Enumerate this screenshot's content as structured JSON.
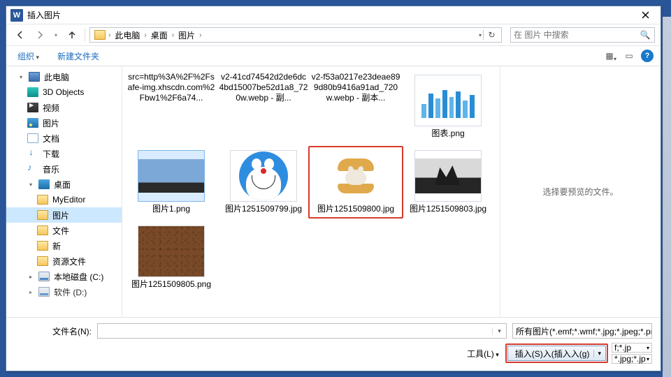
{
  "app_icon_letter": "W",
  "title": "插入图片",
  "nav": {
    "refresh_glyph": "↻",
    "search_glyph": "🔍"
  },
  "breadcrumb": [
    "此电脑",
    "桌面",
    "图片"
  ],
  "search": {
    "placeholder": "在 图片 中搜索"
  },
  "toolbar": {
    "organize": "组织",
    "new_folder": "新建文件夹",
    "view_icon": "▦",
    "preview_icon": "▭"
  },
  "tree": {
    "this_pc": "此电脑",
    "three_d": "3D Objects",
    "videos": "视频",
    "pictures": "图片",
    "documents": "文档",
    "downloads": "下载",
    "music": "音乐",
    "desktop": "桌面",
    "myeditor": "MyEditor",
    "pictures_folder": "图片",
    "files_folder": "文件",
    "new_folder": "新",
    "resources": "资源文件",
    "local_disk": "本地磁盘 (C:)",
    "partial": "软件 (D:)"
  },
  "files": [
    {
      "label": "src=http%3A%2F%2Fsafe-img.xhscdn.com%2Fbw1%2F6a74...",
      "thumb": "none"
    },
    {
      "label": "v2-41cd74542d2de6dc4bd15007be52d1a8_720w.webp - 副...",
      "thumb": "none"
    },
    {
      "label": "v2-f53a0217e23deae899d80b9416a91ad_720w.webp - 副本...",
      "thumb": "none"
    },
    {
      "label": "图表.png",
      "thumb": "chart"
    },
    {
      "label": "图片1.png",
      "thumb": "city",
      "selected": true
    },
    {
      "label": "图片1251509799.jpg",
      "thumb": "dora"
    },
    {
      "label": "图片1251509800.jpg",
      "thumb": "burger",
      "highlight": true
    },
    {
      "label": "图片1251509803.jpg",
      "thumb": "rocks"
    },
    {
      "label": "图片1251509805.png",
      "thumb": "leather"
    }
  ],
  "preview_text": "选择要预览的文件。",
  "footer": {
    "filename_label": "文件名(N):",
    "filetype": "所有图片(*.emf;*.wmf;*.jpg;*.jpeg;*.png;...)",
    "tools": "工具(L)",
    "insert": "插入(S)入(插入入(g)",
    "mini1": "f;*.jp",
    "mini2": "*.jpg;*.jp"
  }
}
